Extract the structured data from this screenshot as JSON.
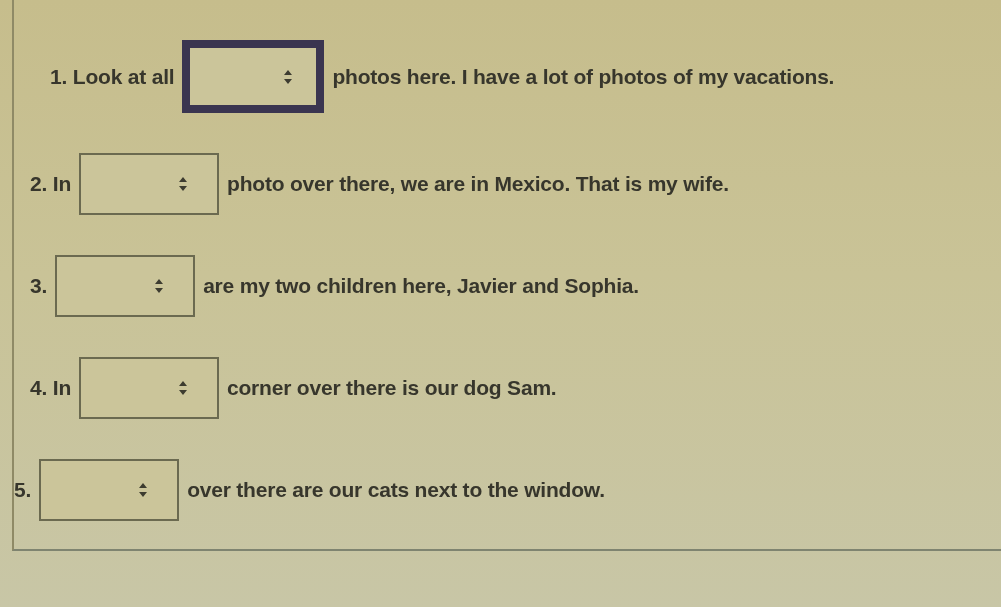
{
  "questions": [
    {
      "prefix": "1. Look at all",
      "suffix": "photos here. I have a lot of photos of my vacations.",
      "focused": true
    },
    {
      "prefix": "2. In",
      "suffix": "photo over there, we are in Mexico. That is my wife.",
      "focused": false
    },
    {
      "prefix": "3.",
      "suffix": "are my two children here, Javier and Sophia.",
      "focused": false
    },
    {
      "prefix": "4. In",
      "suffix": "corner over there is our dog Sam.",
      "focused": false
    },
    {
      "prefix": "5.",
      "suffix": "over there are our cats next to the window.",
      "focused": false
    }
  ]
}
